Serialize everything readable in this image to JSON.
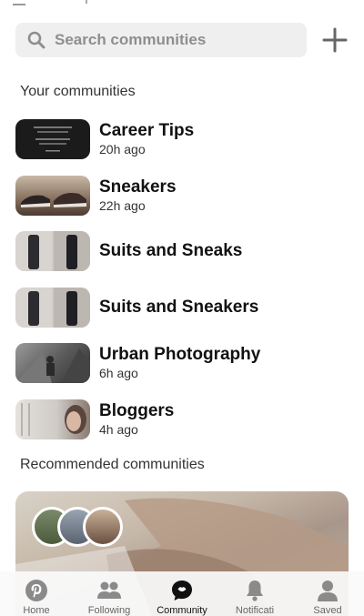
{
  "search": {
    "placeholder": "Search communities"
  },
  "sections": {
    "yours": "Your communities",
    "recommended": "Recommended communities"
  },
  "communities": [
    {
      "name": "Career Tips",
      "time": "20h ago"
    },
    {
      "name": "Sneakers",
      "time": "22h ago"
    },
    {
      "name": "Suits and Sneaks",
      "time": ""
    },
    {
      "name": "Suits and Sneakers",
      "time": ""
    },
    {
      "name": "Urban Photography",
      "time": "6h ago"
    },
    {
      "name": "Bloggers",
      "time": "4h ago"
    }
  ],
  "tabs": [
    {
      "label": "Home",
      "icon": "pinterest-logo-icon"
    },
    {
      "label": "Following",
      "icon": "people-icon"
    },
    {
      "label": "Community",
      "icon": "chat-bubble-icon"
    },
    {
      "label": "Notificati",
      "icon": "bell-icon"
    },
    {
      "label": "Saved",
      "icon": "person-icon"
    }
  ],
  "colors": {
    "accent": "#e60023",
    "background": "#ffffff",
    "search_bg": "#efefef",
    "text": "#111111"
  }
}
